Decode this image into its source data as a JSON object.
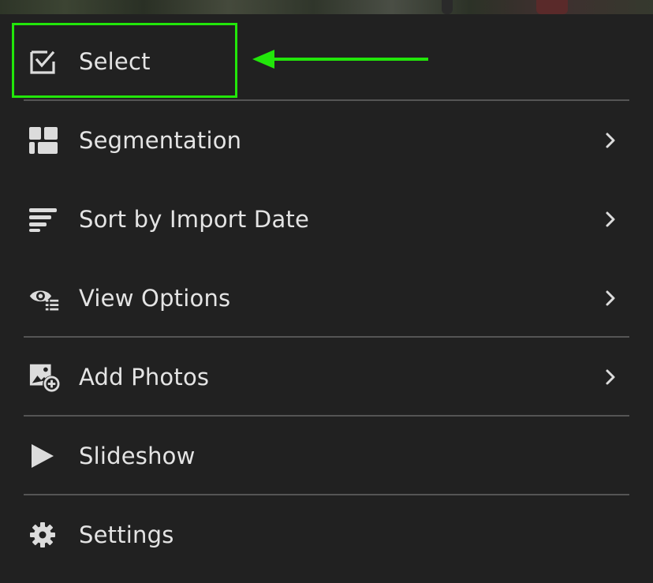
{
  "menu": {
    "items": [
      {
        "label": "Select",
        "icon": "checkbox-icon"
      },
      {
        "label": "Segmentation",
        "icon": "segmentation-grid-icon",
        "submenu": true
      },
      {
        "label": "Sort by Import Date",
        "icon": "sort-lines-icon",
        "submenu": true
      },
      {
        "label": "View Options",
        "icon": "eye-list-icon",
        "submenu": true
      },
      {
        "label": "Add Photos",
        "icon": "add-photo-icon",
        "submenu": true
      },
      {
        "label": "Slideshow",
        "icon": "play-icon"
      },
      {
        "label": "Settings",
        "icon": "gear-icon"
      }
    ]
  },
  "annotation": {
    "target": "Select",
    "color": "#22e60a"
  },
  "colors": {
    "background": "#212121",
    "text": "#e4e4e4",
    "icon": "#dcdcdc",
    "divider": "#555555"
  }
}
